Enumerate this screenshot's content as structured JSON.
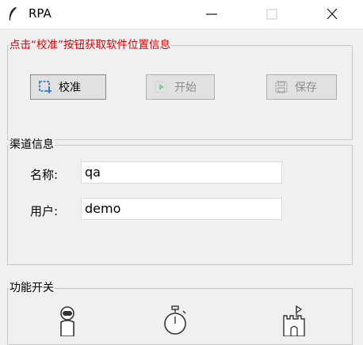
{
  "window": {
    "title": "RPA",
    "minimize_glyph": "—",
    "maximize_glyph": "☐",
    "close_glyph": "✕"
  },
  "calibration": {
    "legend": "点击“校准”按钮获取软件位置信息",
    "calibrate_label": "校准",
    "start_label": "开始",
    "save_label": "保存"
  },
  "channel": {
    "legend": "渠道信息",
    "name_label": "名称:",
    "name_value": "qa",
    "user_label": "用户:",
    "user_value": "demo"
  },
  "features": {
    "legend": "功能开关",
    "icons": [
      "robot-icon",
      "stopwatch-icon",
      "castle-icon"
    ]
  },
  "colors": {
    "accent_red": "#e00000",
    "calibrate_icon": "#1e6fd9",
    "start_icon": "#7fcf9a"
  }
}
